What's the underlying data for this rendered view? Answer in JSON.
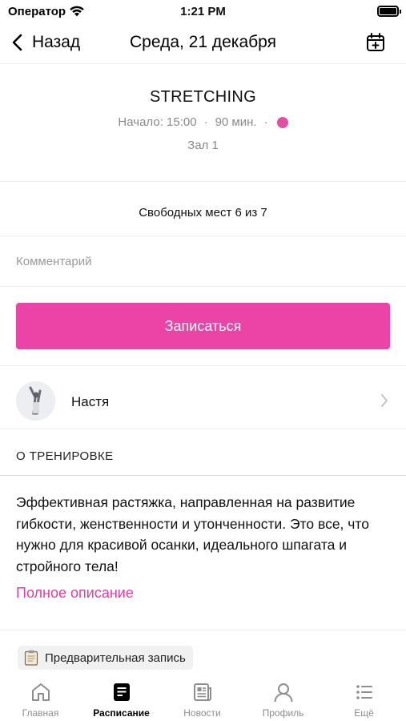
{
  "status_bar": {
    "carrier": "Оператор",
    "time": "1:21 PM"
  },
  "nav": {
    "back_label": "Назад",
    "title": "Среда, 21 декабря",
    "right_icon": "calendar-plus-icon"
  },
  "class_info": {
    "title": "STRETCHING",
    "start": "Начало: 15:00",
    "duration": "90 мин.",
    "separator": "·",
    "color": "#e34ea2",
    "hall": "Зал 1"
  },
  "availability": {
    "text": "Свободных мест 6 из 7"
  },
  "comment": {
    "placeholder": "Комментарий",
    "value": ""
  },
  "signup": {
    "label": "Записаться",
    "color": "#ec44a6"
  },
  "trainer": {
    "name": "Настя"
  },
  "about": {
    "header": "О ТРЕНИРОВКЕ",
    "text": "Эффективная растяжка, направленная на развитие гибкости, женственности и утонченности. Это все, что нужно для красивой осанки, идеального шпагата и стройного тела!",
    "link": "Полное описание",
    "link_color": "#e13ea0"
  },
  "badge": {
    "label": "Предварительная запись",
    "icon": "clipboard-icon"
  },
  "tabs": [
    {
      "label": "Главная",
      "icon": "home-icon",
      "active": false
    },
    {
      "label": "Расписание",
      "icon": "schedule-icon",
      "active": true
    },
    {
      "label": "Новости",
      "icon": "news-icon",
      "active": false
    },
    {
      "label": "Профиль",
      "icon": "profile-icon",
      "active": false
    },
    {
      "label": "Ещё",
      "icon": "more-icon",
      "active": false
    }
  ]
}
